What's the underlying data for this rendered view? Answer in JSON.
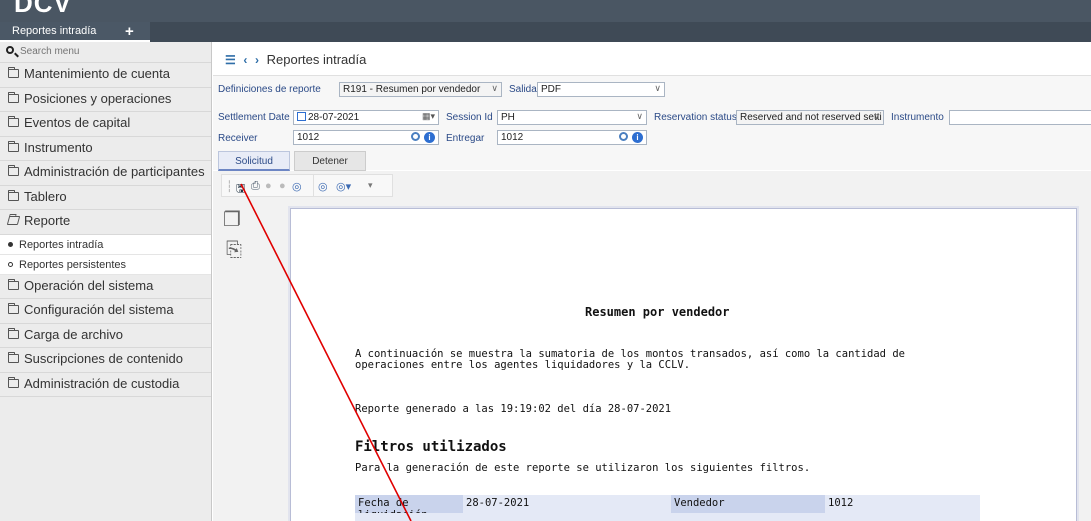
{
  "header": {
    "logo": "DCV",
    "active_tab": "Reportes intradía",
    "add_tab": "+"
  },
  "sidebar": {
    "search_placeholder": "Search menu",
    "items": [
      "Mantenimiento de cuenta",
      "Posiciones y operaciones",
      "Eventos de capital",
      "Instrumento",
      "Administración de participantes",
      "Tablero",
      "Reporte"
    ],
    "sub_items": [
      "Reportes intradía",
      "Reportes persistentes"
    ],
    "items_after": [
      "Operación del sistema",
      "Configuración del sistema",
      "Carga de archivo",
      "Suscripciones de contenido",
      "Administración de custodia"
    ]
  },
  "main": {
    "breadcrumb": "Reportes intradía",
    "form": {
      "def_label": "Definiciones de reporte",
      "def_value": "R191 - Resumen por vendedor",
      "salida_label": "Salida",
      "salida_value": "PDF",
      "settlement_label": "Settlement Date",
      "settlement_value": "28-07-2021",
      "session_label": "Session Id",
      "session_value": "PH",
      "reservation_label": "Reservation status",
      "reservation_value": "Reserved and not reserved setti",
      "instrumento_label": "Instrumento",
      "instrumento_value": "",
      "receiver_label": "Receiver",
      "receiver_value": "1012",
      "entregar_label": "Entregar",
      "entregar_value": "1012"
    },
    "buttons": {
      "solicitud": "Solicitud",
      "detener": "Detener"
    },
    "report": {
      "title": "Resumen por vendedor",
      "desc": "A continuación se muestra la sumatoria de los montos transados, así como la cantidad de operaciones entre los agentes liquidadores y la CCLV.",
      "generated": "Reporte generado a las 19:19:02 del día 28-07-2021",
      "filters_title": "Filtros utilizados",
      "filters_desc": "Para la generación de este reporte se utilizaron los siguientes filtros.",
      "filter_rows": [
        {
          "k1": "Fecha de liquidación",
          "v1": "28-07-2021",
          "k2": "Vendedor",
          "v2": "1012"
        }
      ]
    }
  },
  "colors": {
    "topbar": "#4a5663",
    "sidebar": "#ececec",
    "label_blue": "#2b4a87",
    "filter_row": "#c9d3ec",
    "annotation": "#e00000"
  }
}
